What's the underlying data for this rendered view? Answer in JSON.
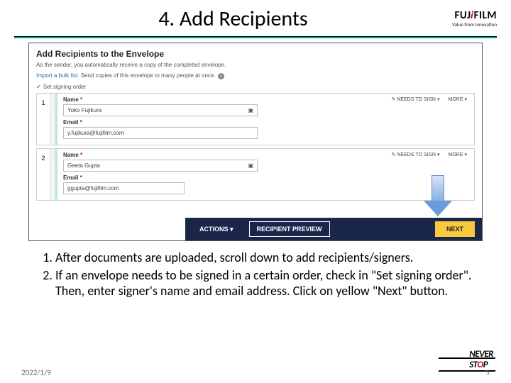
{
  "header": {
    "title": "4. Add Recipients",
    "logo_main_a": "FUJ",
    "logo_main_i": "i",
    "logo_main_b": "FILM",
    "logo_tagline": "Value from Innovation"
  },
  "screenshot": {
    "heading": "Add Recipients to the Envelope",
    "subtext": "As the sender, you automatically receive a copy of the completed envelope.",
    "bulk_link": "Import a bulk list.",
    "bulk_rest": " Send copies of this envelope to many people at once.",
    "signing_order": "Set signing order",
    "needs_to_sign": "NEEDS TO SIGN",
    "more": "MORE",
    "name_label": "Name",
    "email_label": "Email",
    "rec1": {
      "num": "1",
      "name": "Yoko Fujikura",
      "email": "y.fujikura@fujifilm.com"
    },
    "rec2": {
      "num": "2",
      "name": "Geeta Gupta",
      "email": "ggupta@fujifilm.com"
    }
  },
  "bottombar": {
    "actions": "ACTIONS ▾",
    "preview": "RECIPIENT PREVIEW",
    "next": "NEXT"
  },
  "instructions": {
    "item1": "After documents are uploaded, scroll down to add recipients/signers.",
    "item2": "If an envelope needs to be signed in a certain order, check in \"Set signing order\".  Then, enter signer's name and email address.  Click on yellow \"Next\" button."
  },
  "footer": {
    "date": "2022/1/9",
    "page": "5",
    "neverstop_a": "NEVER",
    "neverstop_b": "ST",
    "neverstop_o": "O",
    "neverstop_c": "P"
  }
}
